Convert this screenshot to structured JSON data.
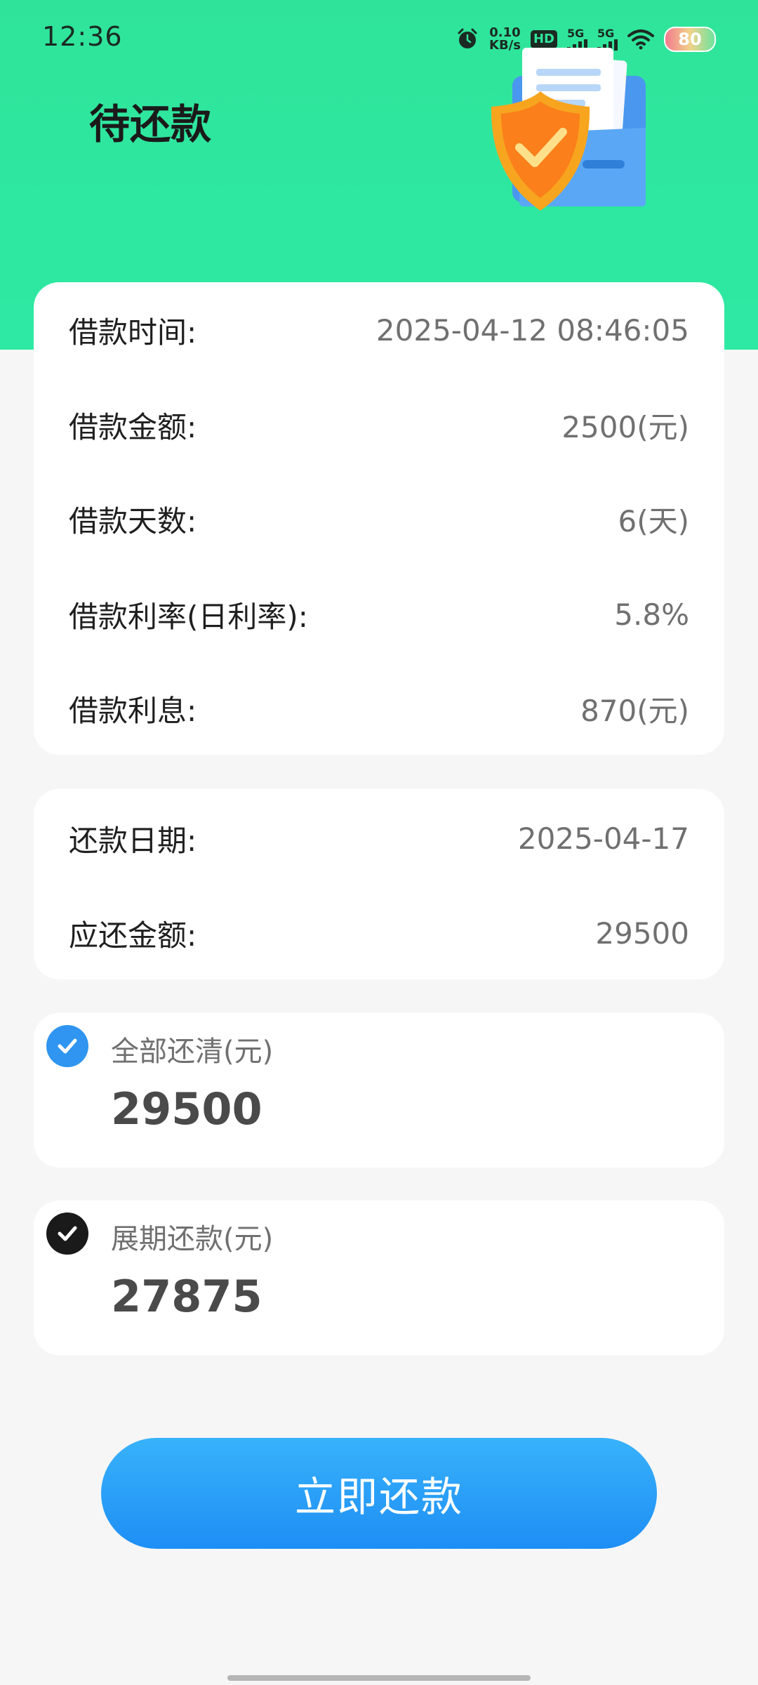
{
  "status_bar": {
    "time": "12:36",
    "net_speed_value": "0.10",
    "net_speed_unit": "KB/s",
    "hd_label": "HD",
    "sim1_label": "5G",
    "sim2_label": "5G",
    "battery": "80"
  },
  "header": {
    "title": "待还款"
  },
  "loan_info": {
    "rows": [
      {
        "label": "借款时间:",
        "value": "2025-04-12 08:46:05"
      },
      {
        "label": "借款金额:",
        "value": "2500(元)"
      },
      {
        "label": "借款天数:",
        "value": "6(天)"
      },
      {
        "label": "借款利率(日利率):",
        "value": "5.8%"
      },
      {
        "label": "借款利息:",
        "value": "870(元)"
      }
    ]
  },
  "repay_info": {
    "rows": [
      {
        "label": "还款日期:",
        "value": "2025-04-17"
      },
      {
        "label": "应还金额:",
        "value": "29500"
      }
    ]
  },
  "options": [
    {
      "label": "全部还清(元)",
      "amount": "29500",
      "selected": true
    },
    {
      "label": "展期还款(元)",
      "amount": "27875",
      "selected": false
    }
  ],
  "action": {
    "repay_button": "立即还款"
  },
  "colors": {
    "header_green": "#2fe49a",
    "accent_blue": "#2f95f0",
    "button_blue": "#1e8ef5"
  }
}
